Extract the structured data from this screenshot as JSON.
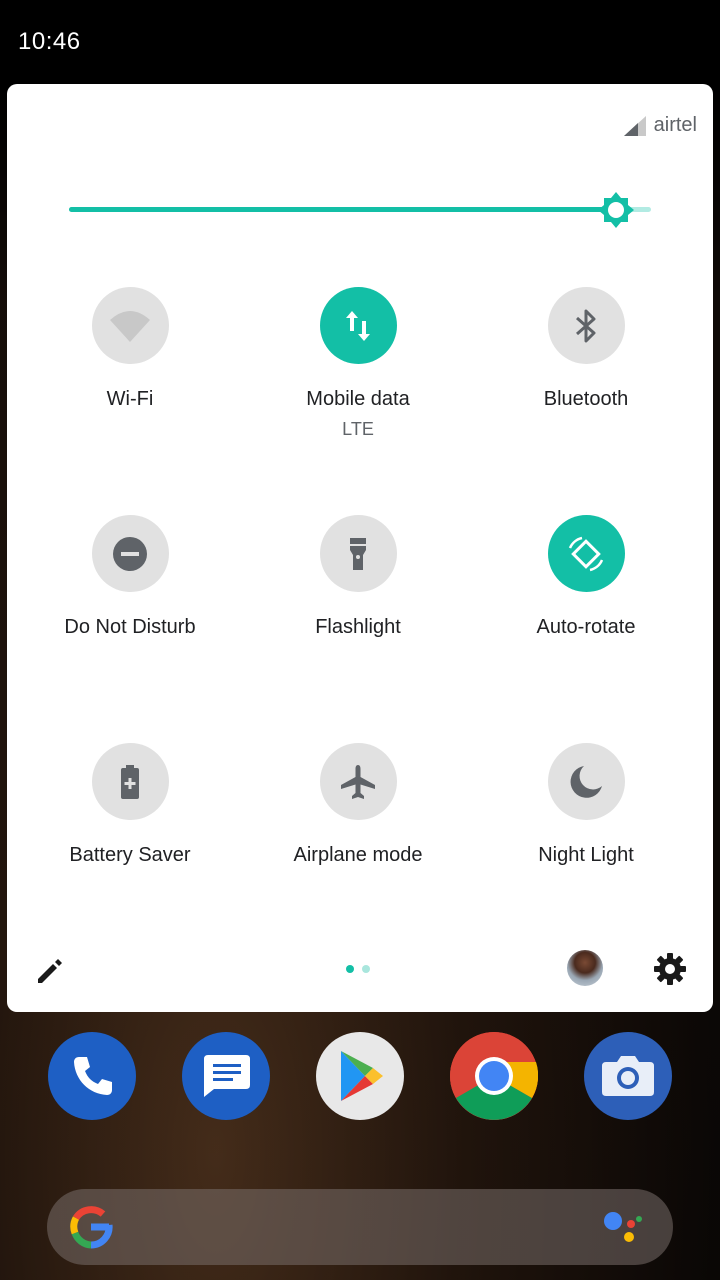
{
  "status_bar": {
    "time": "10:46"
  },
  "quick_settings": {
    "carrier": "airtel",
    "brightness_level": 0.94,
    "tiles": [
      {
        "id": "wifi",
        "label": "Wi-Fi",
        "sublabel": "",
        "icon": "wifi-icon",
        "active": false
      },
      {
        "id": "mobile-data",
        "label": "Mobile data",
        "sublabel": "LTE",
        "icon": "mobile-data-icon",
        "active": true
      },
      {
        "id": "bluetooth",
        "label": "Bluetooth",
        "sublabel": "",
        "icon": "bluetooth-icon",
        "active": false
      },
      {
        "id": "dnd",
        "label": "Do Not Disturb",
        "sublabel": "",
        "icon": "do-not-disturb-icon",
        "active": false
      },
      {
        "id": "flashlight",
        "label": "Flashlight",
        "sublabel": "",
        "icon": "flashlight-icon",
        "active": false
      },
      {
        "id": "auto-rotate",
        "label": "Auto-rotate",
        "sublabel": "",
        "icon": "auto-rotate-icon",
        "active": true
      },
      {
        "id": "battery-saver",
        "label": "Battery Saver",
        "sublabel": "",
        "icon": "battery-saver-icon",
        "active": false
      },
      {
        "id": "airplane",
        "label": "Airplane mode",
        "sublabel": "",
        "icon": "airplane-icon",
        "active": false
      },
      {
        "id": "night-light",
        "label": "Night Light",
        "sublabel": "",
        "icon": "night-light-icon",
        "active": false
      }
    ],
    "page_indicator": {
      "pages": 2,
      "current": 1
    }
  },
  "dock": [
    {
      "app": "Phone",
      "icon": "phone-icon"
    },
    {
      "app": "Messages",
      "icon": "messages-icon"
    },
    {
      "app": "Play Store",
      "icon": "play-store-icon"
    },
    {
      "app": "Chrome",
      "icon": "chrome-icon"
    },
    {
      "app": "Camera",
      "icon": "camera-icon"
    }
  ],
  "colors": {
    "accent": "#13bfa6",
    "tile_off": "#e1e1e1",
    "icon_gray": "#5f6368"
  }
}
